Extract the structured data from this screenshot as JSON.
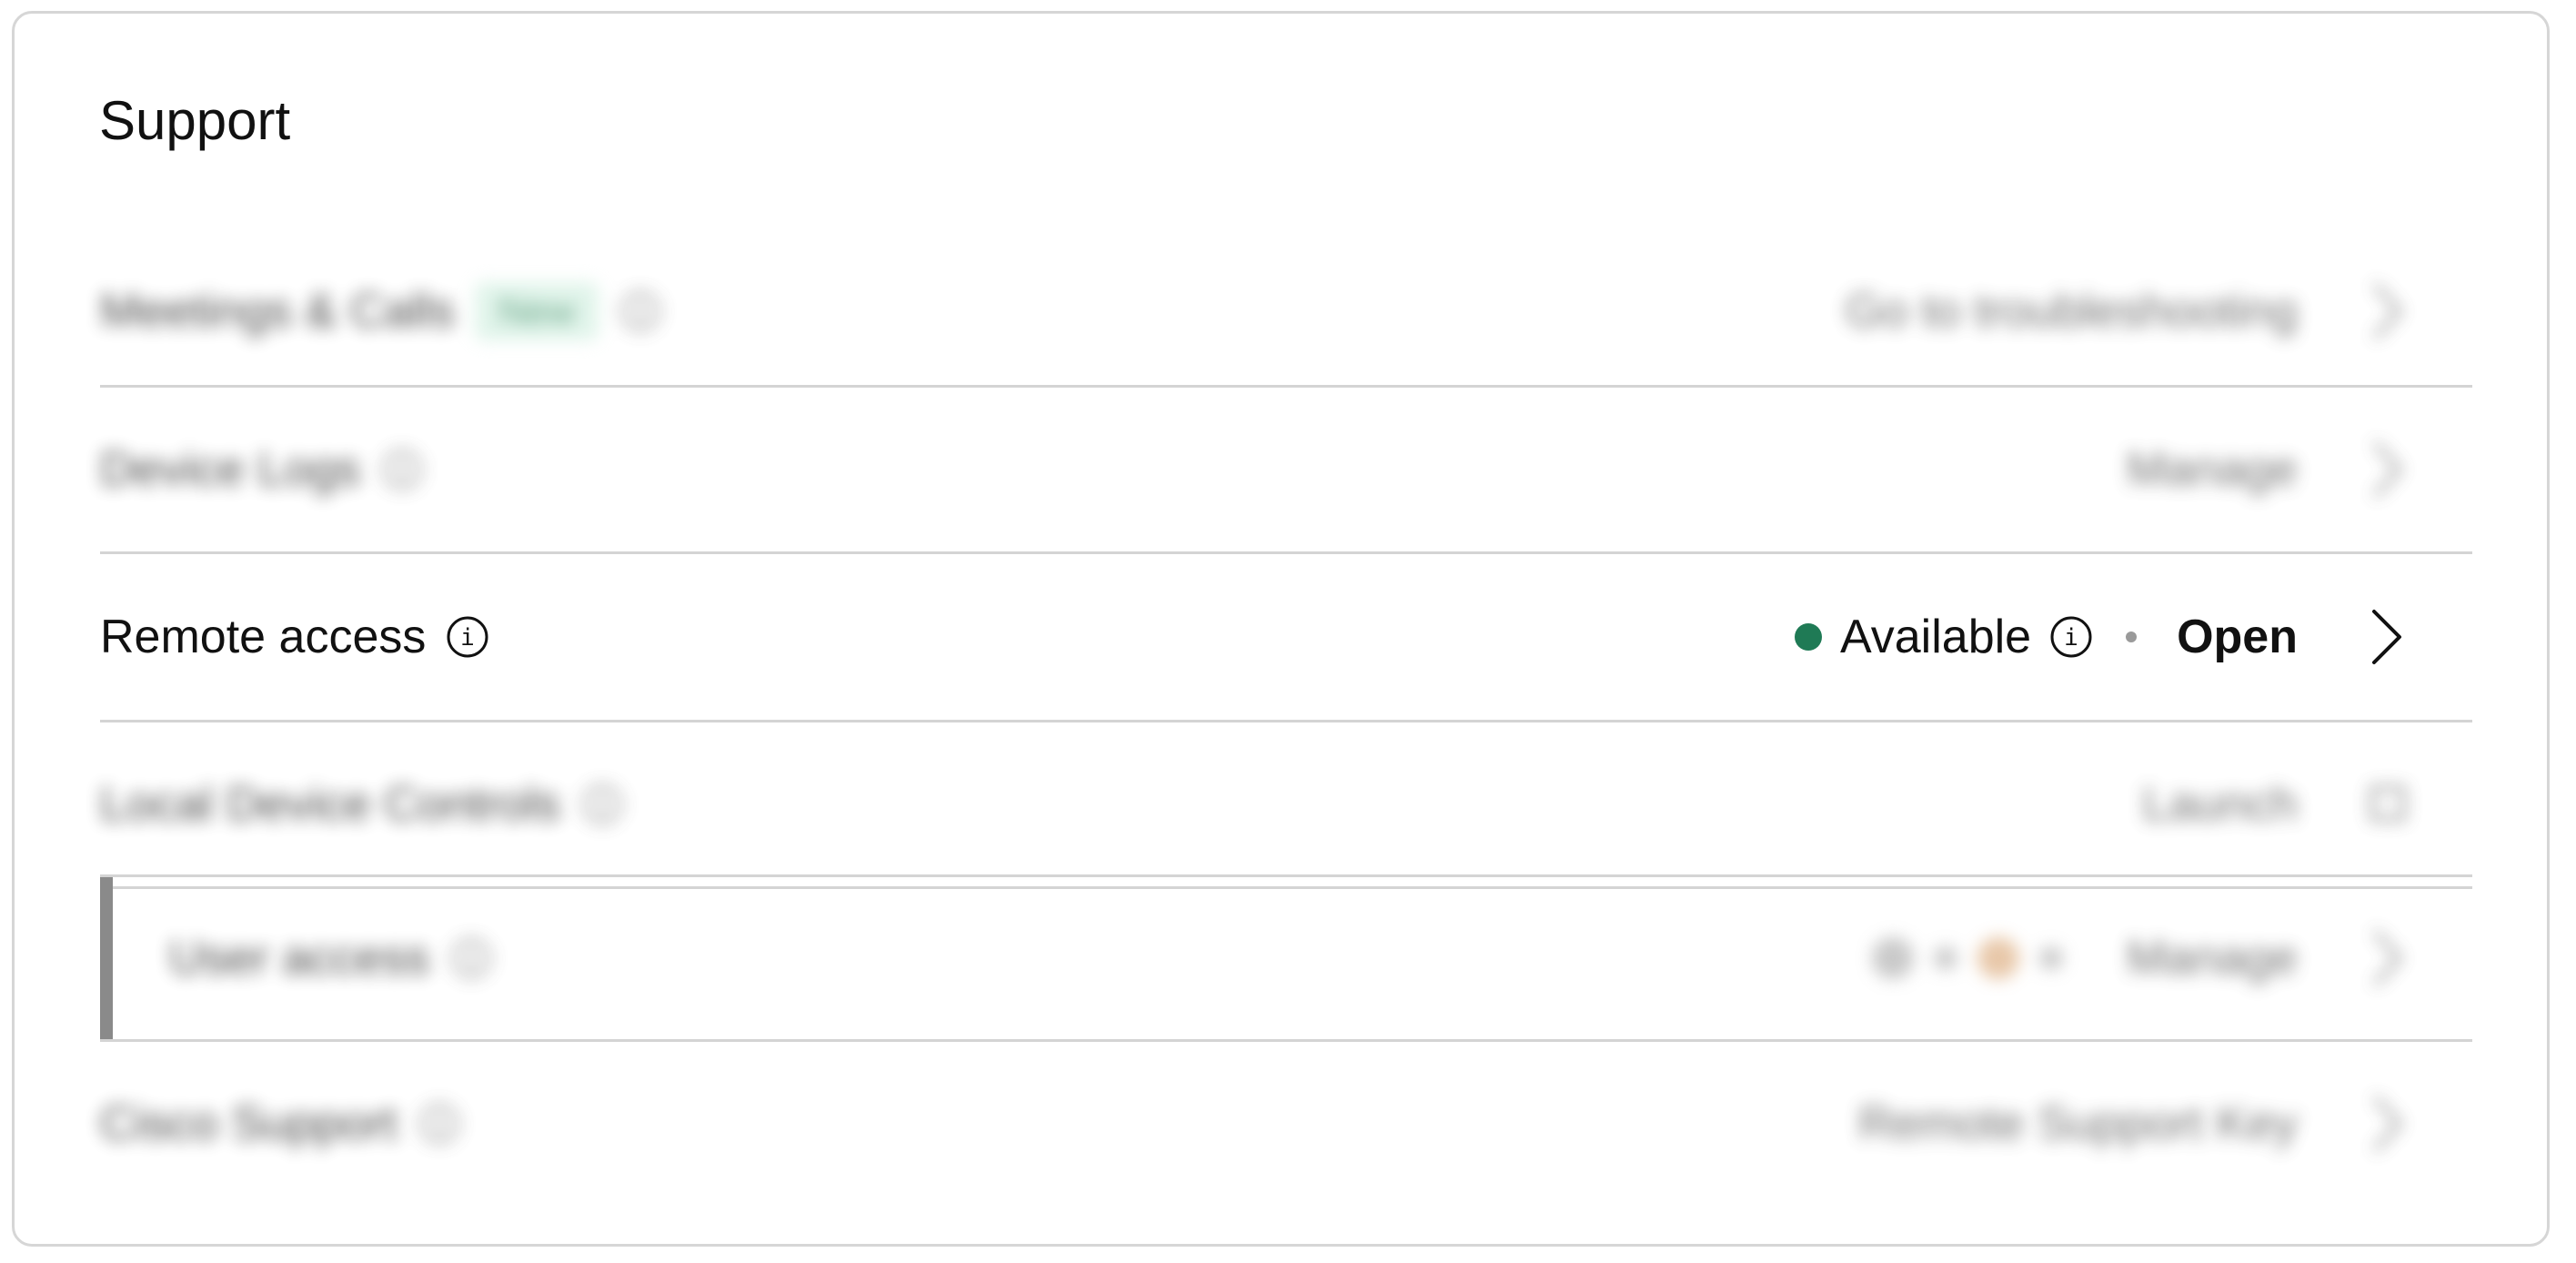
{
  "card": {
    "title": "Support"
  },
  "rows": [
    {
      "label": "Meetings & Calls",
      "badge": "New",
      "action": "Go to troubleshooting",
      "blurred": true
    },
    {
      "label": "Device Logs",
      "action": "Manage",
      "blurred": true
    },
    {
      "label": "Remote access",
      "status": "Available",
      "action": "Open",
      "blurred": false
    },
    {
      "label": "Local Device Controls",
      "action": "Launch",
      "blurred": true
    },
    {
      "label": "User access",
      "action": "Manage",
      "blurred": true
    },
    {
      "label": "Cisco Support",
      "action": "Remote Support Key",
      "blurred": true
    }
  ],
  "icons": {
    "info": "info-icon",
    "chevron": "chevron-right-icon",
    "external": "external-link-icon"
  },
  "colors": {
    "status_available": "#1f7a55",
    "badge_new_bg": "#d7f1e4",
    "divider": "#d4d4d4"
  }
}
